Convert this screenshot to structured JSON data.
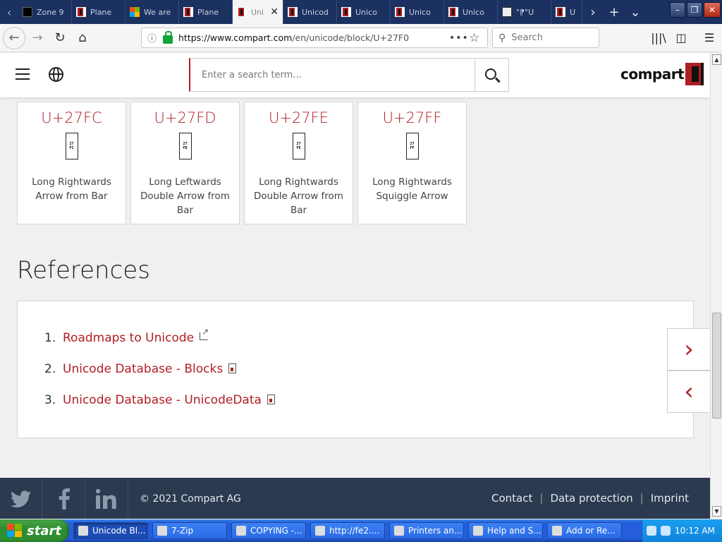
{
  "browser": {
    "tabs": [
      {
        "label": "Zone 9",
        "icon": "zone-favicon"
      },
      {
        "label": "Plane",
        "icon": "compart-favicon"
      },
      {
        "label": "We are",
        "icon": "microsoft-favicon"
      },
      {
        "label": "Plane",
        "icon": "compart-favicon"
      },
      {
        "label": "Uni",
        "icon": "compart-favicon",
        "active": true
      },
      {
        "label": "Unicod",
        "icon": "compart-favicon"
      },
      {
        "label": "Unico",
        "icon": "compart-favicon"
      },
      {
        "label": "Unico",
        "icon": "compart-favicon"
      },
      {
        "label": "Unico",
        "icon": "compart-favicon"
      },
      {
        "label": "\"⁋\"U",
        "icon": "glyph-favicon"
      },
      {
        "label": "U",
        "icon": "compart-favicon"
      }
    ],
    "url_host": "https://www.compart.com",
    "url_path": "/en/unicode/block/U+27F0",
    "search_placeholder": "Search"
  },
  "site": {
    "search_placeholder": "Enter a search term...",
    "logo_text": "compart"
  },
  "cards": [
    {
      "code": "U+27FC",
      "glyph_top": "27",
      "glyph_bottom": "FC",
      "name": "Long Rightwards Arrow from Bar"
    },
    {
      "code": "U+27FD",
      "glyph_top": "27",
      "glyph_bottom": "FD",
      "name": "Long Leftwards Double Arrow from Bar"
    },
    {
      "code": "U+27FE",
      "glyph_top": "27",
      "glyph_bottom": "FE",
      "name": "Long Rightwards Double Arrow from Bar"
    },
    {
      "code": "U+27FF",
      "glyph_top": "27",
      "glyph_bottom": "FF",
      "name": "Long Rightwards Squiggle Arrow"
    }
  ],
  "references": {
    "heading": "References",
    "items": [
      {
        "num": "1.",
        "label": "Roadmaps to Unicode",
        "icon": "external-link-icon"
      },
      {
        "num": "2.",
        "label": "Unicode Database - Blocks",
        "icon": "document-icon"
      },
      {
        "num": "3.",
        "label": "Unicode Database - UnicodeData",
        "icon": "document-icon"
      }
    ]
  },
  "side_nav": {
    "next": "›",
    "prev": "‹"
  },
  "footer": {
    "copyright": "© 2021 Compart AG",
    "links": [
      "Contact",
      "Data protection",
      "Imprint"
    ],
    "social": [
      "twitter",
      "facebook",
      "linkedin"
    ]
  },
  "taskbar": {
    "start_label": "start",
    "items": [
      {
        "label": "Unicode Bl..."
      },
      {
        "label": "7-Zip"
      },
      {
        "label": "COPYING -..."
      },
      {
        "label": "http://fe2...."
      },
      {
        "label": "Printers an..."
      },
      {
        "label": "Help and S..."
      },
      {
        "label": "Add or Re..."
      }
    ],
    "clock": "10:12 AM"
  },
  "colors": {
    "accent": "#b01e23",
    "footer_bg": "#2b3a4f",
    "tabstrip_bg": "#1b3160"
  }
}
